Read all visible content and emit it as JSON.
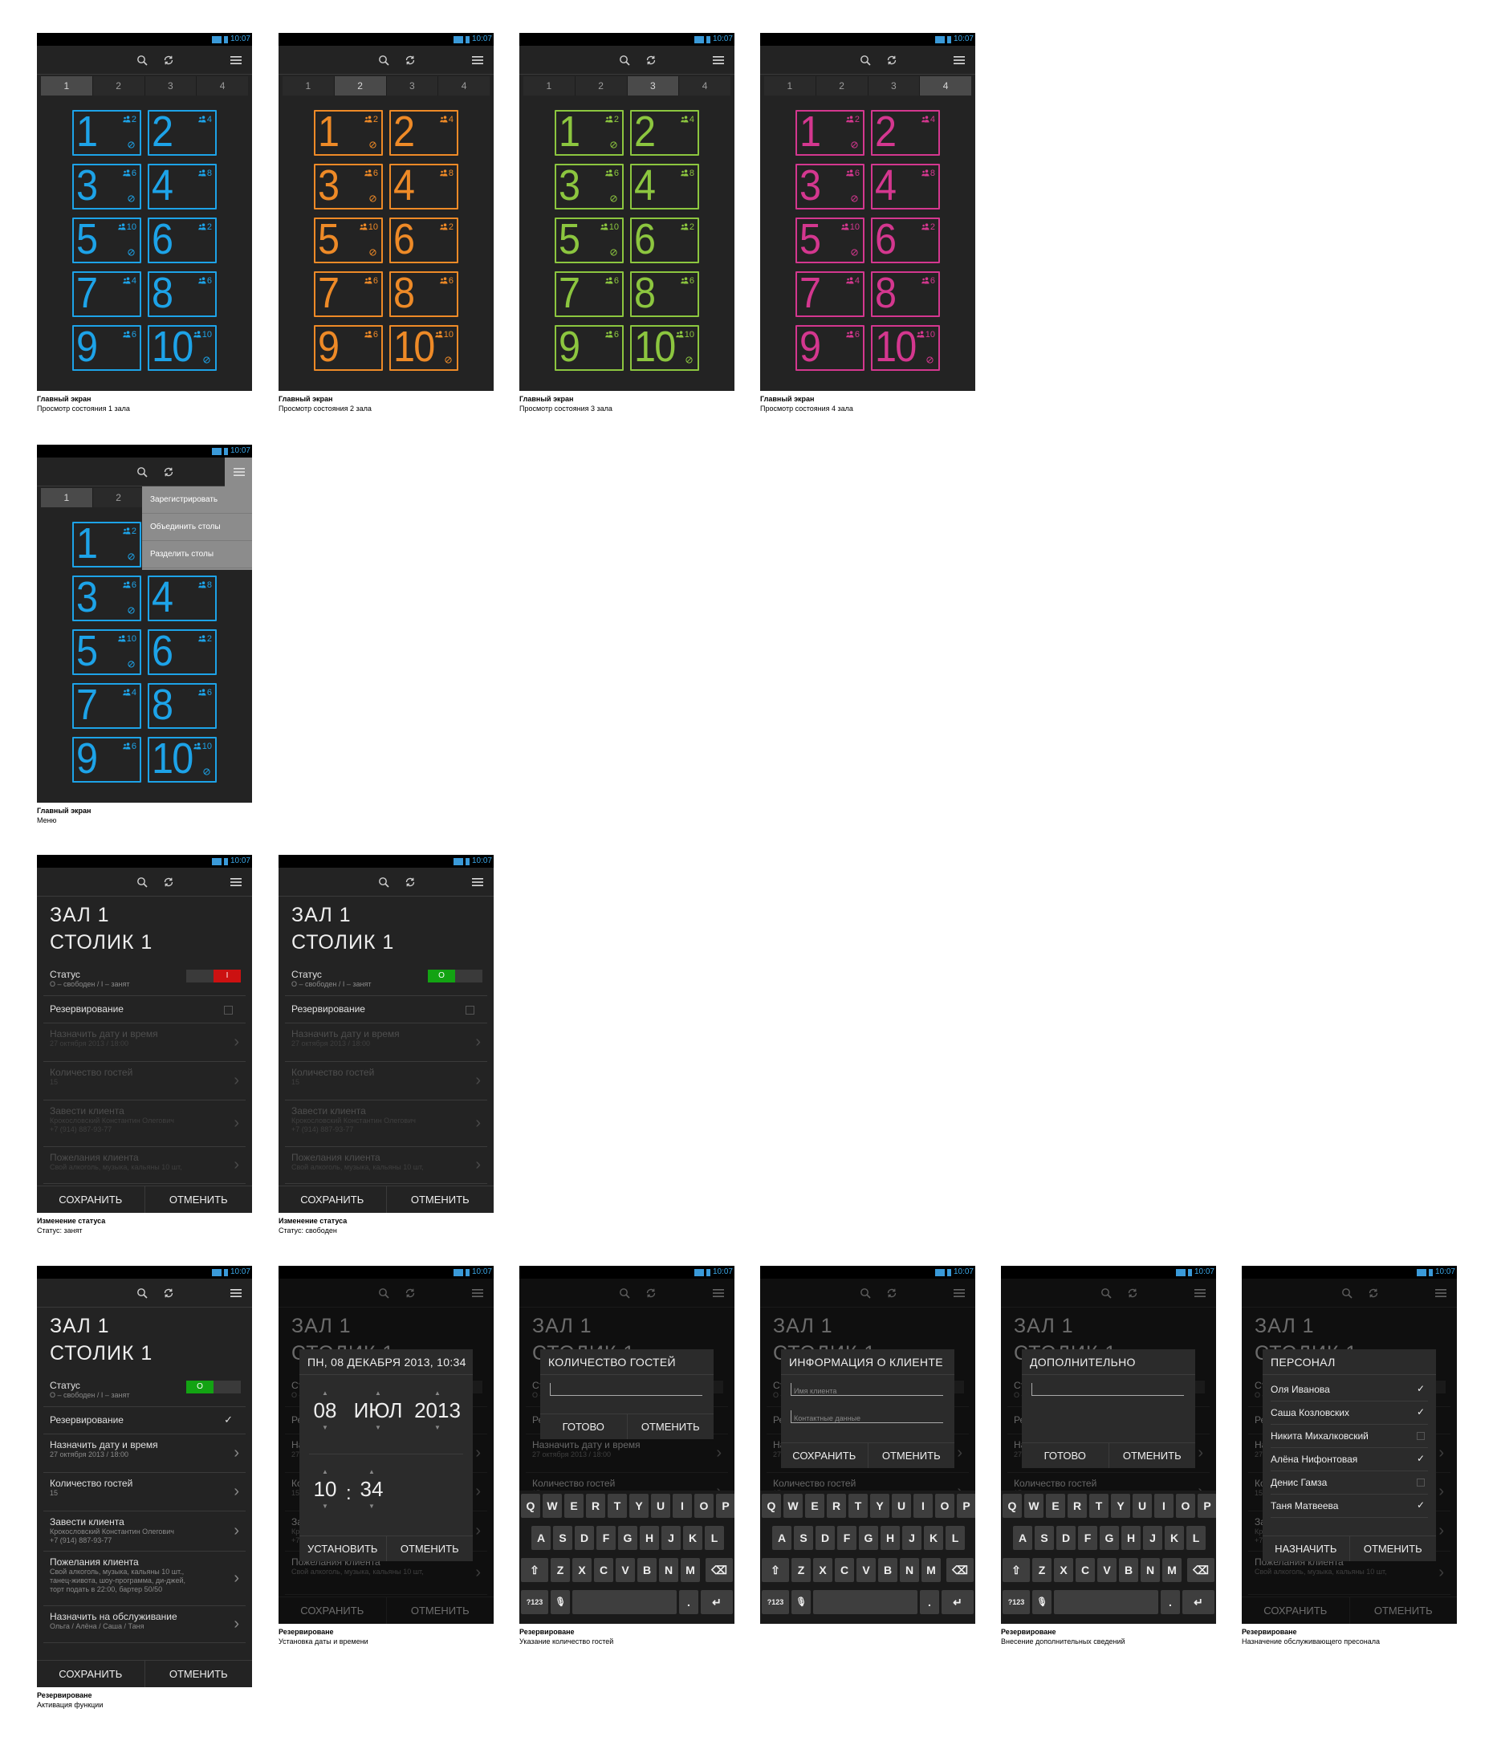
{
  "status_bar": {
    "time": "10:07"
  },
  "icons": {
    "search": "search-icon",
    "sync": "sync-icon",
    "menu": "menu-icon"
  },
  "tabs": [
    "1",
    "2",
    "3",
    "4"
  ],
  "colors": {
    "hall1": "#1da3e8",
    "hall2": "#ee8a27",
    "hall3": "#8cc63f",
    "hall4": "#d4378f",
    "busy": "#cc1111",
    "free": "#13a313"
  },
  "tables": [
    {
      "num": "1",
      "seats": "2",
      "reserved": true
    },
    {
      "num": "2",
      "seats": "4",
      "reserved": false
    },
    {
      "num": "3",
      "seats": "6",
      "reserved": true
    },
    {
      "num": "4",
      "seats": "8",
      "reserved": false
    },
    {
      "num": "5",
      "seats": "10",
      "reserved": true
    },
    {
      "num": "6",
      "seats": "2",
      "reserved": false
    },
    {
      "num": "7",
      "seats": "4",
      "reserved": false
    },
    {
      "num": "8",
      "seats": "6",
      "reserved": false
    },
    {
      "num": "9",
      "seats": "6",
      "reserved": false
    },
    {
      "num": "10",
      "seats": "10",
      "reserved": true
    }
  ],
  "hall_tables_alt": {
    "7": "6"
  },
  "menu": {
    "items": [
      "Зарегистрировать",
      "Объединить столы",
      "Разделить столы"
    ]
  },
  "form": {
    "hall": "ЗАЛ 1",
    "table": "СТОЛИК 1",
    "status_label": "Статус",
    "status_sub": "O – свободен / I – занят",
    "busy_value": "I",
    "free_value": "O",
    "reservation_label": "Резервирование",
    "date_label": "Назначить дату и время",
    "date_sub": "27 октября 2013 / 18:00",
    "guests_label": "Количество гостей",
    "guests_sub": "15",
    "client_label": "Завести клиента",
    "client_sub": "Крокословский Константин Олегович\n+7 (914) 887-93-77",
    "wishes_label": "Пожелания клиента",
    "wishes_sub_short": "Свой алкоголь, музыка, кальяны 10 шт,",
    "wishes_sub": "Свой алкоголь, музыка, кальяны 10 шт.,\nтанец-живота, шоу-программа, ди-джей,\nторт подать в 22:00, бартер 50/50",
    "staff_label": "Назначить на обслуживание",
    "staff_sub": "Ольга / Алёна / Саша / Таня",
    "save": "СОХРАНИТЬ",
    "cancel": "ОТМЕНИТЬ"
  },
  "dialogs": {
    "datetime": {
      "title": "ПН, 08 ДЕКАБРЯ 2013, 10:34",
      "day": "08",
      "month": "ИЮЛ",
      "year": "2013",
      "hour": "10",
      "sep": ":",
      "minute": "34",
      "ok": "УСТАНОВИТЬ",
      "cancel": "ОТМЕНИТЬ"
    },
    "guests": {
      "title": "КОЛИЧЕСТВО ГОСТЕЙ",
      "ok": "ГОТОВО",
      "cancel": "ОТМЕНИТЬ"
    },
    "client": {
      "title": "ИНФОРМАЦИЯ О КЛИЕНТЕ",
      "name_ph": "Имя клиента",
      "contact_ph": "Контактные данные",
      "ok": "СОХРАНИТЬ",
      "cancel": "ОТМЕНИТЬ"
    },
    "extra": {
      "title": "ДОПОЛНИТЕЛЬНО",
      "ok": "ГОТОВО",
      "cancel": "ОТМЕНИТЬ"
    },
    "staff": {
      "title": "ПЕРСОНАЛ",
      "ok": "НАЗНАЧИТЬ",
      "cancel": "ОТМЕНИТЬ",
      "people": [
        {
          "name": "Оля Иванова",
          "checked": true
        },
        {
          "name": "Саша Козловских",
          "checked": true
        },
        {
          "name": "Никита Михалковский",
          "checked": false
        },
        {
          "name": "Алёна Нифонтовая",
          "checked": true
        },
        {
          "name": "Денис Гамза",
          "checked": false
        },
        {
          "name": "Таня Матвеева",
          "checked": true
        }
      ]
    }
  },
  "keyboard": {
    "row1": [
      "Q",
      "W",
      "E",
      "R",
      "T",
      "Y",
      "U",
      "I",
      "O",
      "P"
    ],
    "row2": [
      "A",
      "S",
      "D",
      "F",
      "G",
      "H",
      "J",
      "K",
      "L"
    ],
    "row3": [
      "Z",
      "X",
      "C",
      "V",
      "B",
      "N",
      "M"
    ],
    "sym": "?123",
    "dot": "."
  },
  "captions": [
    {
      "title": "Главный экран",
      "sub": "Просмотр состояния 1 зала"
    },
    {
      "title": "Главный экран",
      "sub": "Просмотр состояния 2 зала"
    },
    {
      "title": "Главный экран",
      "sub": "Просмотр состояния 3 зала"
    },
    {
      "title": "Главный экран",
      "sub": "Просмотр состояния 4 зала"
    },
    {
      "title": "Главный экран",
      "sub": "Меню"
    },
    {
      "title": "Изменение статуса",
      "sub": "Статус: занят"
    },
    {
      "title": "Изменение статуса",
      "sub": "Статус: свободен"
    },
    {
      "title": "Резервироване",
      "sub": "Активация функции"
    },
    {
      "title": "Резервироване",
      "sub": "Установка даты и времени"
    },
    {
      "title": "Резервироване",
      "sub": "Указание количество гостей"
    },
    {
      "title": "Резервироване",
      "sub": "Внесение дополнительных сведений"
    },
    {
      "title": "Резервироване",
      "sub": "Назначение обслуживающего пресонала"
    }
  ]
}
